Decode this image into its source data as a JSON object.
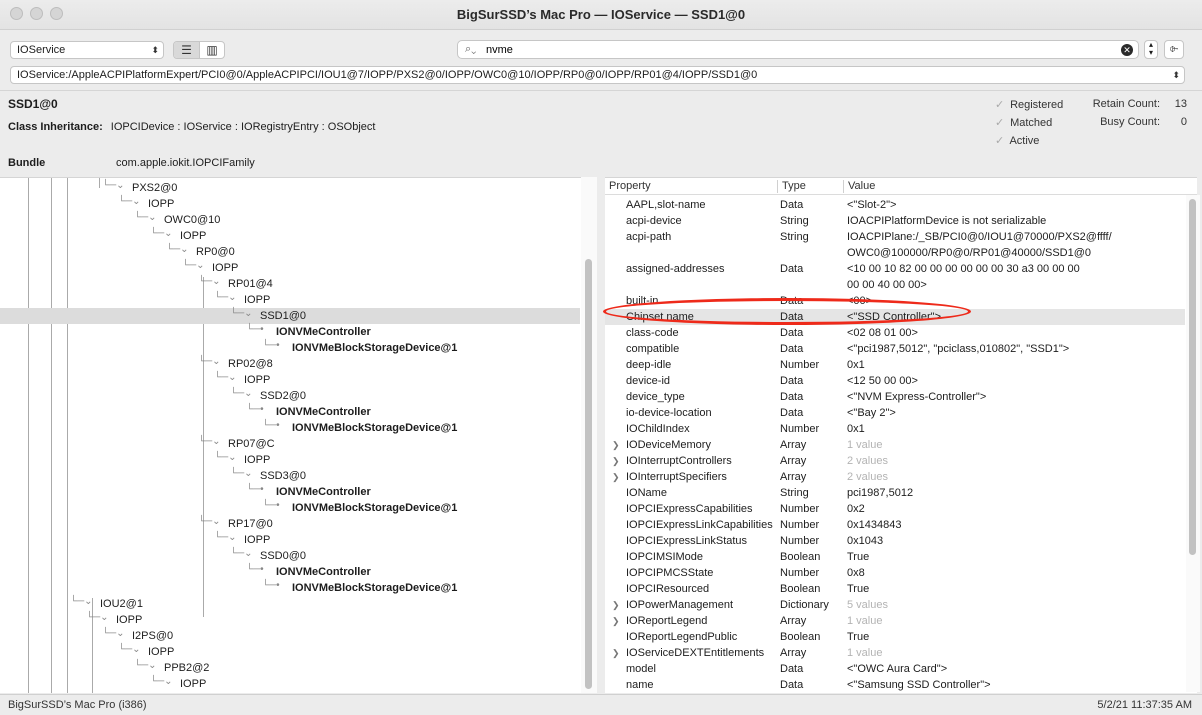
{
  "window": {
    "title": "BigSurSSD’s Mac Pro — IOService — SSD1@0"
  },
  "toolbar": {
    "plane": "IOService",
    "search_value": "nvme",
    "path": "IOService:/AppleACPIPlatformExpert/PCI0@0/AppleACPIPCI/IOU1@7/IOPP/PXS2@0/IOPP/OWC0@10/IOPP/RP0@0/IOPP/RP01@4/IOPP/SSD1@0"
  },
  "info": {
    "object_name": "SSD1@0",
    "class_label": "Class Inheritance:",
    "class_value": "IOPCIDevice : IOService : IORegistryEntry : OSObject",
    "bundle_label": "Bundle",
    "bundle_value": "com.apple.iokit.IOPCIFamily",
    "registered": "Registered",
    "matched": "Matched",
    "active": "Active",
    "retain_label": "Retain Count:",
    "retain_value": "13",
    "busy_label": "Busy Count:",
    "busy_value": "0"
  },
  "tree": [
    {
      "label": "PXS2@0",
      "bold": false,
      "selected": false
    },
    {
      "label": "IOPP",
      "bold": false,
      "selected": false
    },
    {
      "label": "OWC0@10",
      "bold": false,
      "selected": false
    },
    {
      "label": "IOPP",
      "bold": false,
      "selected": false
    },
    {
      "label": "RP0@0",
      "bold": false,
      "selected": false
    },
    {
      "label": "IOPP",
      "bold": false,
      "selected": false
    },
    {
      "label": "RP01@4",
      "bold": false,
      "selected": false
    },
    {
      "label": "IOPP",
      "bold": false,
      "selected": false
    },
    {
      "label": "SSD1@0",
      "bold": false,
      "selected": true
    },
    {
      "label": "IONVMeController",
      "bold": true,
      "selected": false
    },
    {
      "label": "IONVMeBlockStorageDevice@1",
      "bold": true,
      "selected": false
    },
    {
      "label": "RP02@8",
      "bold": false,
      "selected": false
    },
    {
      "label": "IOPP",
      "bold": false,
      "selected": false
    },
    {
      "label": "SSD2@0",
      "bold": false,
      "selected": false
    },
    {
      "label": "IONVMeController",
      "bold": true,
      "selected": false
    },
    {
      "label": "IONVMeBlockStorageDevice@1",
      "bold": true,
      "selected": false
    },
    {
      "label": "RP07@C",
      "bold": false,
      "selected": false
    },
    {
      "label": "IOPP",
      "bold": false,
      "selected": false
    },
    {
      "label": "SSD3@0",
      "bold": false,
      "selected": false
    },
    {
      "label": "IONVMeController",
      "bold": true,
      "selected": false
    },
    {
      "label": "IONVMeBlockStorageDevice@1",
      "bold": true,
      "selected": false
    },
    {
      "label": "RP17@0",
      "bold": false,
      "selected": false
    },
    {
      "label": "IOPP",
      "bold": false,
      "selected": false
    },
    {
      "label": "SSD0@0",
      "bold": false,
      "selected": false
    },
    {
      "label": "IONVMeController",
      "bold": true,
      "selected": false
    },
    {
      "label": "IONVMeBlockStorageDevice@1",
      "bold": true,
      "selected": false
    },
    {
      "label": "IOU2@1",
      "bold": false,
      "selected": false
    },
    {
      "label": "IOPP",
      "bold": false,
      "selected": false
    },
    {
      "label": "I2PS@0",
      "bold": false,
      "selected": false
    },
    {
      "label": "IOPP",
      "bold": false,
      "selected": false
    },
    {
      "label": "PPB2@2",
      "bold": false,
      "selected": false
    },
    {
      "label": "IOPP",
      "bold": false,
      "selected": false
    }
  ],
  "properties": {
    "headers": {
      "property": "Property",
      "type": "Type",
      "value": "Value"
    },
    "rows": [
      {
        "name": "AAPL,slot-name",
        "type": "Data",
        "value": "<\"Slot-2\">",
        "value2": "",
        "expandable": false,
        "dim": false
      },
      {
        "name": "acpi-device",
        "type": "String",
        "value": "IOACPIPlatformDevice is not serializable",
        "value2": "",
        "expandable": false,
        "dim": false
      },
      {
        "name": "acpi-path",
        "type": "String",
        "value": "IOACPIPlane:/_SB/PCI0@0/IOU1@70000/PXS2@ffff/",
        "value2": "OWC0@100000/RP0@0/RP01@40000/SSD1@0",
        "expandable": false,
        "dim": false
      },
      {
        "name": "assigned-addresses",
        "type": "Data",
        "value": "<10 00 10 82 00 00 00 00 00 00 30 a3 00 00 00",
        "value2": " 00 00 40 00 00>",
        "expandable": false,
        "dim": false
      },
      {
        "name": "built-in",
        "type": "Data",
        "value": "<00>",
        "value2": "",
        "expandable": false,
        "dim": false
      },
      {
        "name": "Chipset name",
        "type": "Data",
        "value": "<\"SSD Controller\">",
        "value2": "",
        "expandable": false,
        "dim": false,
        "selected": true
      },
      {
        "name": "class-code",
        "type": "Data",
        "value": "<02 08 01 00>",
        "value2": "",
        "expandable": false,
        "dim": false
      },
      {
        "name": "compatible",
        "type": "Data",
        "value": "<\"pci1987,5012\", \"pciclass,010802\", \"SSD1\">",
        "value2": "",
        "expandable": false,
        "dim": false
      },
      {
        "name": "deep-idle",
        "type": "Number",
        "value": "0x1",
        "value2": "",
        "expandable": false,
        "dim": false
      },
      {
        "name": "device-id",
        "type": "Data",
        "value": "<12 50 00 00>",
        "value2": "",
        "expandable": false,
        "dim": false
      },
      {
        "name": "device_type",
        "type": "Data",
        "value": "<\"NVM Express-Controller\">",
        "value2": "",
        "expandable": false,
        "dim": false
      },
      {
        "name": "io-device-location",
        "type": "Data",
        "value": "<\"Bay 2\">",
        "value2": "",
        "expandable": false,
        "dim": false
      },
      {
        "name": "IOChildIndex",
        "type": "Number",
        "value": "0x1",
        "value2": "",
        "expandable": false,
        "dim": false
      },
      {
        "name": "IODeviceMemory",
        "type": "Array",
        "value": "1 value",
        "value2": "",
        "expandable": true,
        "dim": true
      },
      {
        "name": "IOInterruptControllers",
        "type": "Array",
        "value": "2 values",
        "value2": "",
        "expandable": true,
        "dim": true
      },
      {
        "name": "IOInterruptSpecifiers",
        "type": "Array",
        "value": "2 values",
        "value2": "",
        "expandable": true,
        "dim": true
      },
      {
        "name": "IOName",
        "type": "String",
        "value": "pci1987,5012",
        "value2": "",
        "expandable": false,
        "dim": false
      },
      {
        "name": "IOPCIExpressCapabilities",
        "type": "Number",
        "value": "0x2",
        "value2": "",
        "expandable": false,
        "dim": false
      },
      {
        "name": "IOPCIExpressLinkCapabilities",
        "type": "Number",
        "value": "0x1434843",
        "value2": "",
        "expandable": false,
        "dim": false
      },
      {
        "name": "IOPCIExpressLinkStatus",
        "type": "Number",
        "value": "0x1043",
        "value2": "",
        "expandable": false,
        "dim": false
      },
      {
        "name": "IOPCIMSIMode",
        "type": "Boolean",
        "value": "True",
        "value2": "",
        "expandable": false,
        "dim": false
      },
      {
        "name": "IOPCIPMCSState",
        "type": "Number",
        "value": "0x8",
        "value2": "",
        "expandable": false,
        "dim": false
      },
      {
        "name": "IOPCIResourced",
        "type": "Boolean",
        "value": "True",
        "value2": "",
        "expandable": false,
        "dim": false
      },
      {
        "name": "IOPowerManagement",
        "type": "Dictionary",
        "value": "5 values",
        "value2": "",
        "expandable": true,
        "dim": true
      },
      {
        "name": "IOReportLegend",
        "type": "Array",
        "value": "1 value",
        "value2": "",
        "expandable": true,
        "dim": true
      },
      {
        "name": "IOReportLegendPublic",
        "type": "Boolean",
        "value": "True",
        "value2": "",
        "expandable": false,
        "dim": false
      },
      {
        "name": "IOServiceDEXTEntitlements",
        "type": "Array",
        "value": "1 value",
        "value2": "",
        "expandable": true,
        "dim": true
      },
      {
        "name": "model",
        "type": "Data",
        "value": "<\"OWC Aura Card\">",
        "value2": "",
        "expandable": false,
        "dim": false
      },
      {
        "name": "name",
        "type": "Data",
        "value": "<\"Samsung SSD Controller\">",
        "value2": "",
        "expandable": false,
        "dim": false
      }
    ]
  },
  "status": {
    "machine": "BigSurSSD’s Mac Pro (i386)",
    "timestamp": "5/2/21 11:37:35 AM"
  },
  "colors": {
    "highlight_ring": "#ee2a1a",
    "selection": "#dcdcdc"
  }
}
